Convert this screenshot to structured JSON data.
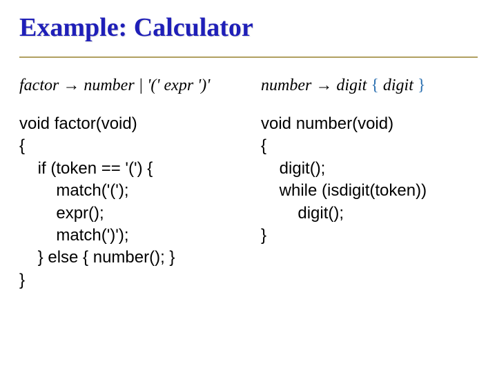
{
  "title": "Example: Calculator",
  "left": {
    "grammar": {
      "lhs": "factor",
      "rhs": "number | '(' expr ')'"
    },
    "code": "void factor(void)\n{\n    if (token == '(') {\n        match('(');\n        expr();\n        match(')');\n    } else { number(); }\n}"
  },
  "right": {
    "grammar": {
      "lhs": "number",
      "rhs_pre": "digit",
      "rhs_open": "{",
      "rhs_mid": "digit",
      "rhs_close": "}"
    },
    "code": "void number(void)\n{\n    digit();\n    while (isdigit(token))\n        digit();\n}"
  },
  "glyphs": {
    "arrow": "→"
  }
}
